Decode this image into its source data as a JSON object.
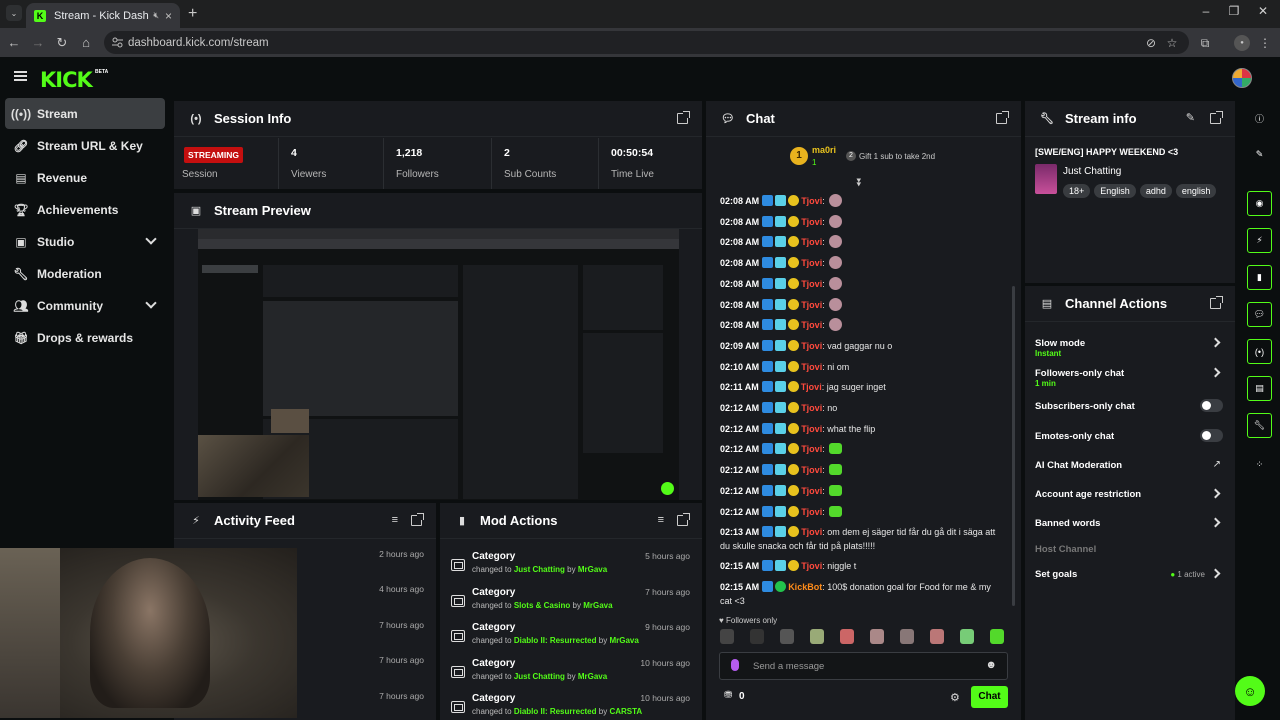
{
  "browser": {
    "tab_title": "Stream - Kick Dashboard",
    "url": "dashboard.kick.com/stream"
  },
  "header": {
    "logo": "KICK",
    "beta": "BETA"
  },
  "sidebar": {
    "items": [
      {
        "label": "Stream",
        "icon": "broadcast-icon"
      },
      {
        "label": "Stream URL & Key",
        "icon": "link-icon"
      },
      {
        "label": "Revenue",
        "icon": "chart-icon"
      },
      {
        "label": "Achievements",
        "icon": "trophy-icon"
      },
      {
        "label": "Studio",
        "icon": "studio-icon"
      },
      {
        "label": "Moderation",
        "icon": "wrench-icon"
      },
      {
        "label": "Community",
        "icon": "users-icon"
      },
      {
        "label": "Drops & rewards",
        "icon": "gift-icon"
      }
    ]
  },
  "session": {
    "title": "Session Info",
    "status": "STREAMING",
    "status_label": "Session",
    "stats": [
      {
        "value": "4",
        "label": "Viewers"
      },
      {
        "value": "1,218",
        "label": "Followers"
      },
      {
        "value": "2",
        "label": "Sub Counts"
      },
      {
        "value": "00:50:54",
        "label": "Time Live"
      }
    ]
  },
  "preview": {
    "title": "Stream Preview"
  },
  "activity": {
    "title": "Activity Feed",
    "times": [
      "2 hours ago",
      "4 hours ago",
      "7 hours ago",
      "7 hours ago",
      "7 hours ago"
    ]
  },
  "mod": {
    "title": "Mod Actions",
    "rows": [
      {
        "title": "Category",
        "prefix": "changed to",
        "target": "Just Chatting",
        "by": "by",
        "user": "MrGava",
        "time": "5 hours ago"
      },
      {
        "title": "Category",
        "prefix": "changed to",
        "target": "Slots & Casino",
        "by": "by",
        "user": "MrGava",
        "time": "7 hours ago"
      },
      {
        "title": "Category",
        "prefix": "changed to",
        "target": "Diablo II: Resurrected",
        "by": "by",
        "user": "MrGava",
        "time": "9 hours ago"
      },
      {
        "title": "Category",
        "prefix": "changed to",
        "target": "Just Chatting",
        "by": "by",
        "user": "MrGava",
        "time": "10 hours ago"
      },
      {
        "title": "Category",
        "prefix": "changed to",
        "target": "Diablo II: Resurrected",
        "by": "by",
        "user": "CARSTA",
        "time": "10 hours ago"
      }
    ]
  },
  "chat": {
    "title": "Chat",
    "top_gifter": {
      "name": "ma0ri",
      "count": "1",
      "rank": "1"
    },
    "gift_prompt": "Gift 1 sub to take 2nd",
    "messages": [
      {
        "time": "02:08 AM",
        "user": "Tjovi",
        "text": ""
      },
      {
        "time": "02:08 AM",
        "user": "Tjovi",
        "text": ""
      },
      {
        "time": "02:08 AM",
        "user": "Tjovi",
        "text": ""
      },
      {
        "time": "02:08 AM",
        "user": "Tjovi",
        "text": ""
      },
      {
        "time": "02:08 AM",
        "user": "Tjovi",
        "text": ""
      },
      {
        "time": "02:08 AM",
        "user": "Tjovi",
        "text": ""
      },
      {
        "time": "02:08 AM",
        "user": "Tjovi",
        "text": ""
      },
      {
        "time": "02:09 AM",
        "user": "Tjovi",
        "text": "vad gaggar nu o"
      },
      {
        "time": "02:10 AM",
        "user": "Tjovi",
        "text": "ni om"
      },
      {
        "time": "02:11 AM",
        "user": "Tjovi",
        "text": "jag suger inget"
      },
      {
        "time": "02:12 AM",
        "user": "Tjovi",
        "text": "no"
      },
      {
        "time": "02:12 AM",
        "user": "Tjovi",
        "text": "what the flip"
      },
      {
        "time": "02:12 AM",
        "user": "Tjovi",
        "text": ""
      },
      {
        "time": "02:12 AM",
        "user": "Tjovi",
        "text": ""
      },
      {
        "time": "02:12 AM",
        "user": "Tjovi",
        "text": ""
      },
      {
        "time": "02:12 AM",
        "user": "Tjovi",
        "text": ""
      },
      {
        "time": "02:13 AM",
        "user": "Tjovi",
        "text": "om dem ej säger tid får du gå dit i säga att du skulle snacka och får tid på plats!!!!!"
      },
      {
        "time": "02:15 AM",
        "user": "Tjovi",
        "text": "niggle t"
      },
      {
        "time": "02:15 AM",
        "user": "KickBot",
        "text": "100$ donation goal for Food for me & my cat <3"
      }
    ],
    "followers_only": "Followers only",
    "placeholder": "Send a message",
    "viewer_count": "0",
    "send_label": "Chat"
  },
  "stream_info": {
    "title": "Stream info",
    "stream_title": "[SWE/ENG] HAPPY WEEKEND <3",
    "category": "Just Chatting",
    "tags": [
      "18+",
      "English",
      "adhd",
      "english"
    ]
  },
  "channel_actions": {
    "title": "Channel Actions",
    "items": [
      {
        "name": "Slow mode",
        "sub": "Instant",
        "control": "arrow"
      },
      {
        "name": "Followers-only chat",
        "sub": "1 min",
        "control": "arrow"
      },
      {
        "name": "Subscribers-only chat",
        "sub": "",
        "control": "toggle"
      },
      {
        "name": "Emotes-only chat",
        "sub": "",
        "control": "toggle"
      },
      {
        "name": "AI Chat Moderation",
        "sub": "",
        "control": "external"
      },
      {
        "name": "Account age restriction",
        "sub": "",
        "control": "arrow"
      },
      {
        "name": "Banned words",
        "sub": "",
        "control": "arrow"
      },
      {
        "name": "Host Channel",
        "sub": "",
        "control": "none"
      },
      {
        "name": "Set goals",
        "sub": "",
        "control": "arrow",
        "status": "1 active"
      }
    ]
  },
  "colors": {
    "accent": "#53fc18",
    "live": "#c40f0f",
    "panel": "#191b1f",
    "username": "#ff4a3d"
  }
}
